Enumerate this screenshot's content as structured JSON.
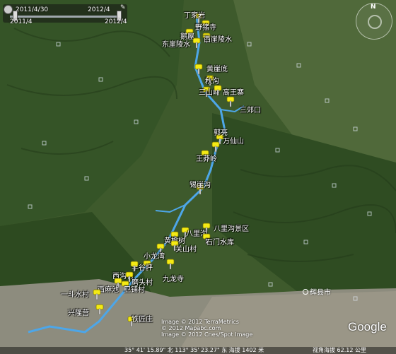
{
  "time_slider": {
    "start_date": "2011/4/30",
    "end_date": "2012/4",
    "range_start": "2011/4",
    "range_end": "2012/4"
  },
  "places": [
    {
      "name": "丁家岩"
    },
    {
      "name": "野猪寺"
    },
    {
      "name": "鹅屋"
    },
    {
      "name": "东崖陵水"
    },
    {
      "name": "西崖陵水"
    },
    {
      "name": "黄崖底"
    },
    {
      "name": "秋沟"
    },
    {
      "name": "三山岭"
    },
    {
      "name": "高王寨"
    },
    {
      "name": "三郊口"
    },
    {
      "name": "郭亮"
    },
    {
      "name": "万仙山"
    },
    {
      "name": "王莽岭"
    },
    {
      "name": "锡崖沟"
    },
    {
      "name": "八里沟景区"
    },
    {
      "name": "八里沟"
    },
    {
      "name": "石门水库"
    },
    {
      "name": "黄榆树"
    },
    {
      "name": "关山村"
    },
    {
      "name": "小龙湾"
    },
    {
      "name": "羊谷坪"
    },
    {
      "name": "西沟村"
    },
    {
      "name": "磨头村"
    },
    {
      "name": "九龙寺"
    },
    {
      "name": "西麻池"
    },
    {
      "name": "卫铺村"
    },
    {
      "name": "一斗水村"
    },
    {
      "name": "兴隆营"
    },
    {
      "name": "铁匠庄"
    }
  ],
  "city": {
    "label": "辉县市"
  },
  "credits": {
    "line1": "Image © 2012 TerraMetrics",
    "line2": "© 2012 Mapabc.com",
    "line3": "Image © 2012 Cnes/Spot Image"
  },
  "logo": "Google",
  "status": {
    "coords": "35° 41' 15.89\" 北 113° 35' 23.27\" 东 海拔 1402 米",
    "eye_alt": "视角海拔 62.12 公里"
  },
  "nav": {
    "north_label": "N"
  },
  "colors": {
    "river": "#4da6e8",
    "pin": "#f4ea14",
    "forest": "#3d5a2c",
    "plain": "#8a8f7a"
  }
}
